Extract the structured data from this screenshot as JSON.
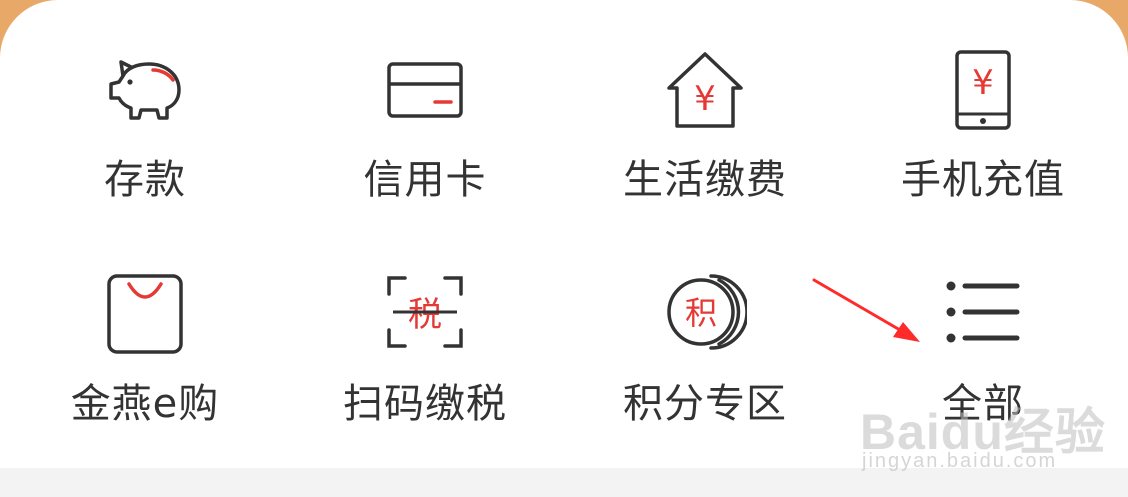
{
  "colors": {
    "header_orange": "#e8a968",
    "icon_dark": "#333333",
    "icon_red": "#e53935",
    "label_text": "#333333",
    "arrow_red": "#ff2a2a",
    "bottom_band": "#f3f3f3"
  },
  "menu": {
    "items": [
      {
        "label": "存款",
        "icon": "piggy-bank-icon"
      },
      {
        "label": "信用卡",
        "icon": "credit-card-icon"
      },
      {
        "label": "生活缴费",
        "icon": "house-yuan-icon"
      },
      {
        "label": "手机充值",
        "icon": "phone-yuan-icon"
      },
      {
        "label": "金燕e购",
        "icon": "shopping-bag-icon"
      },
      {
        "label": "扫码缴税",
        "icon": "scan-tax-icon",
        "icon_text": "税"
      },
      {
        "label": "积分专区",
        "icon": "points-coin-icon",
        "icon_text": "积"
      },
      {
        "label": "全部",
        "icon": "list-icon"
      }
    ]
  },
  "yuan_symbol": "¥",
  "watermark": {
    "main": "Baidu经验",
    "sub": "jingyan.baidu.com"
  }
}
